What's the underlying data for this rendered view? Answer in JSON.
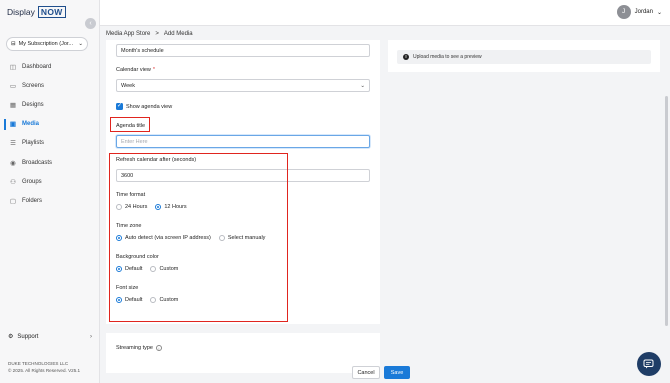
{
  "app": {
    "logo_text": "Display",
    "logo_badge": "NOW"
  },
  "sidebar": {
    "collapse_icon": "chevron-left-icon",
    "subscription": {
      "icon": "subscription-icon",
      "label": "My Subscription (Jor...",
      "chevron": "chevron-down-icon"
    },
    "items": [
      {
        "label": "Dashboard",
        "icon": "dashboard-icon",
        "glyph": "◫"
      },
      {
        "label": "Screens",
        "icon": "screen-icon",
        "glyph": "▭"
      },
      {
        "label": "Designs",
        "icon": "designs-icon",
        "glyph": "▦"
      },
      {
        "label": "Media",
        "icon": "media-icon",
        "glyph": "▣"
      },
      {
        "label": "Playlists",
        "icon": "playlist-icon",
        "glyph": "☰"
      },
      {
        "label": "Broadcasts",
        "icon": "broadcast-icon",
        "glyph": "◉"
      },
      {
        "label": "Groups",
        "icon": "groups-icon",
        "glyph": "⚇"
      },
      {
        "label": "Folders",
        "icon": "folder-icon",
        "glyph": "▢"
      }
    ],
    "active_item": "Media",
    "support_label": "Support",
    "footer_line1": "DUKE TECHNOLOGIES LLC",
    "footer_line2": "© 2025. All Rights Reserved. V25.1"
  },
  "topbar": {
    "user_initial": "J",
    "user_name": "Jordan"
  },
  "breadcrumb": {
    "parent": "Media App Store",
    "separator": ">",
    "current": "Add Media"
  },
  "form": {
    "name_value": "Month's schedule",
    "calendar_view_label": "Calendar view",
    "calendar_view_required": "*",
    "calendar_view_value": "Week",
    "show_agenda_label": "Show agenda view",
    "show_agenda_checked": true,
    "agenda_title_label": "Agenda title",
    "agenda_title_placeholder": "Enter Here",
    "refresh_label": "Refresh calendar after (seconds)",
    "refresh_value": "3600",
    "time_format_label": "Time format",
    "time_format_options": [
      "24 Hours",
      "12 Hours"
    ],
    "time_format_selected": "12 Hours",
    "time_zone_label": "Time zone",
    "time_zone_options": [
      "Auto detect (via screen IP address)",
      "Select manualy"
    ],
    "time_zone_selected": "Auto detect (via screen IP address)",
    "bg_color_label": "Background color",
    "bg_color_options": [
      "Default",
      "Custom"
    ],
    "bg_color_selected": "Default",
    "font_size_label": "Font size",
    "font_size_options": [
      "Default",
      "Custom"
    ],
    "font_size_selected": "Default",
    "streaming_type_label": "Streaming type"
  },
  "preview": {
    "message": "Upload media to see a preview"
  },
  "actions": {
    "cancel_label": "Cancel",
    "save_label": "Save"
  },
  "colors": {
    "accent": "#1a7ad8",
    "highlight": "#e0251f",
    "chat": "#1f3d66"
  }
}
